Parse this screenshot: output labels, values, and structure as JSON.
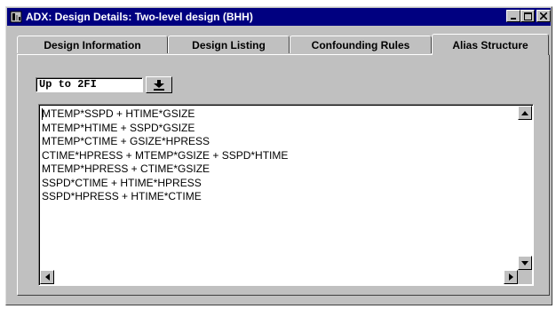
{
  "window": {
    "title": "ADX: Design Details: Two-level design (BHH)"
  },
  "tabs": [
    {
      "label": "Design Information",
      "active": false
    },
    {
      "label": "Design Listing",
      "active": false
    },
    {
      "label": "Confounding Rules",
      "active": false
    },
    {
      "label": "Alias Structure",
      "active": true
    }
  ],
  "alias": {
    "selected_option": "Up to 2FI",
    "lines": [
      "MTEMP*SSPD + HTIME*GSIZE",
      "MTEMP*HTIME + SSPD*GSIZE",
      "MTEMP*CTIME + GSIZE*HPRESS",
      "CTIME*HPRESS + MTEMP*GSIZE + SSPD*HTIME",
      "MTEMP*HPRESS + CTIME*GSIZE",
      "SSPD*CTIME + HTIME*HPRESS",
      "SSPD*HPRESS + HTIME*CTIME"
    ]
  },
  "icons": {
    "app": "app-icon",
    "minimize": "minimize-icon",
    "maximize": "maximize-icon",
    "close": "close-icon",
    "dropdown": "dropdown-arrow-icon"
  },
  "colors": {
    "titlebar": "#000080",
    "face": "#c0c0c0"
  }
}
